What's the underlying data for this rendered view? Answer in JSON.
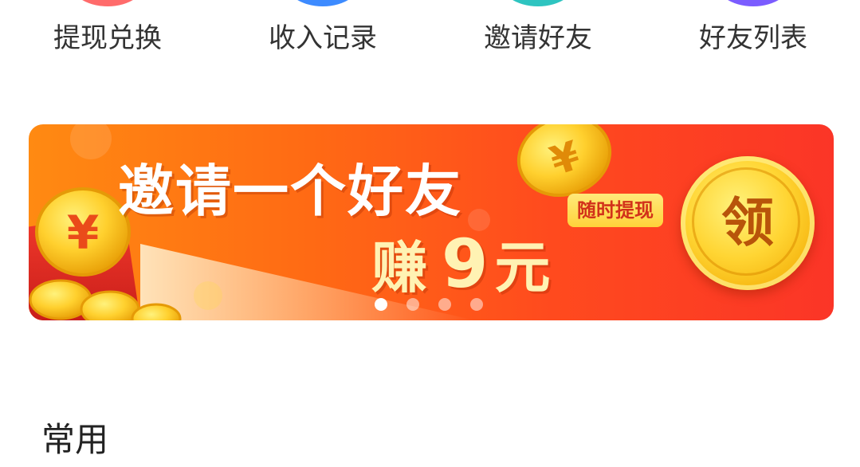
{
  "quick_actions": [
    {
      "label": "提现兑换",
      "icon": "withdraw-icon",
      "color": "#ff6b6b"
    },
    {
      "label": "收入记录",
      "icon": "income-record-icon",
      "color": "#3d8bff"
    },
    {
      "label": "邀请好友",
      "icon": "invite-friend-icon",
      "color": "#2ec4c0"
    },
    {
      "label": "好友列表",
      "icon": "friend-list-icon",
      "color": "#7b5cff"
    }
  ],
  "banner": {
    "title": "邀请一个好友",
    "earn_verb": "赚",
    "earn_amount": "9",
    "earn_unit": "元",
    "badge": "随时提现",
    "claim_label": "领",
    "coin_symbol": "¥",
    "page_count": 4,
    "active_page": 0
  },
  "section": {
    "title": "常用"
  }
}
